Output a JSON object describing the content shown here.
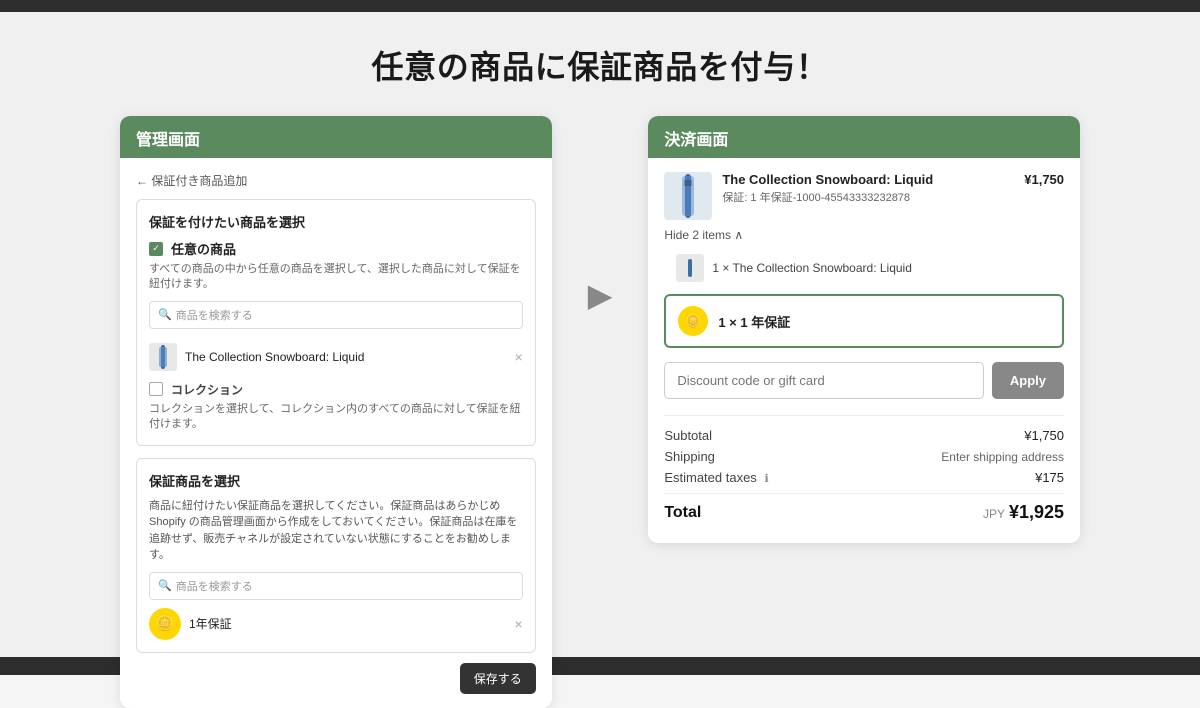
{
  "page": {
    "title": "任意の商品に保証商品を付与！",
    "bg_accent": "#4a7c59"
  },
  "admin_panel": {
    "header_label": "管理画面",
    "back_link": "← 保証付き商品追加",
    "product_select_title": "保証を付けたい商品を選択",
    "any_product_label": "任意の商品",
    "any_product_desc": "すべての商品の中から任意の商品を選択して、選択した商品に対して保証を紐付けます。",
    "search_placeholder": "商品を検索する",
    "product_name": "The Collection Snowboard: Liquid",
    "collection_label": "コレクション",
    "collection_desc": "コレクションを選択して、コレクション内のすべての商品に対して保証を紐付けます。",
    "warranty_select_title": "保証商品を選択",
    "warranty_desc": "商品に紐付けたい保証商品を選択してください。保証商品はあらかじめ Shopify の商品管理画面から作成をしておいてください。保証商品は在庫を追跡せず、販売チャネルが設定されていない状態にすることをお勧めします。",
    "warranty_search_placeholder": "商品を検索する",
    "warranty_product_name": "1年保証",
    "save_button_label": "保存する"
  },
  "checkout_panel": {
    "header_label": "決済画面",
    "product_name": "The Collection Snowboard: Liquid",
    "product_warranty_info": "保証: 1 年保証-1000-45543333232878",
    "product_price": "¥1,750",
    "hide_items_link": "Hide 2 items ∧",
    "sub_item_1": "1 × The Collection Snowboard: Liquid",
    "sub_item_warranty": "1 × 1 年保証",
    "discount_placeholder": "Discount code or gift card",
    "apply_button": "Apply",
    "subtotal_label": "Subtotal",
    "subtotal_value": "¥1,750",
    "shipping_label": "Shipping",
    "shipping_value": "Enter shipping address",
    "taxes_label": "Estimated taxes",
    "taxes_info": "ℹ",
    "taxes_value": "¥175",
    "total_label": "Total",
    "total_currency": "JPY",
    "total_value": "¥1,925"
  },
  "arrow": "▶"
}
